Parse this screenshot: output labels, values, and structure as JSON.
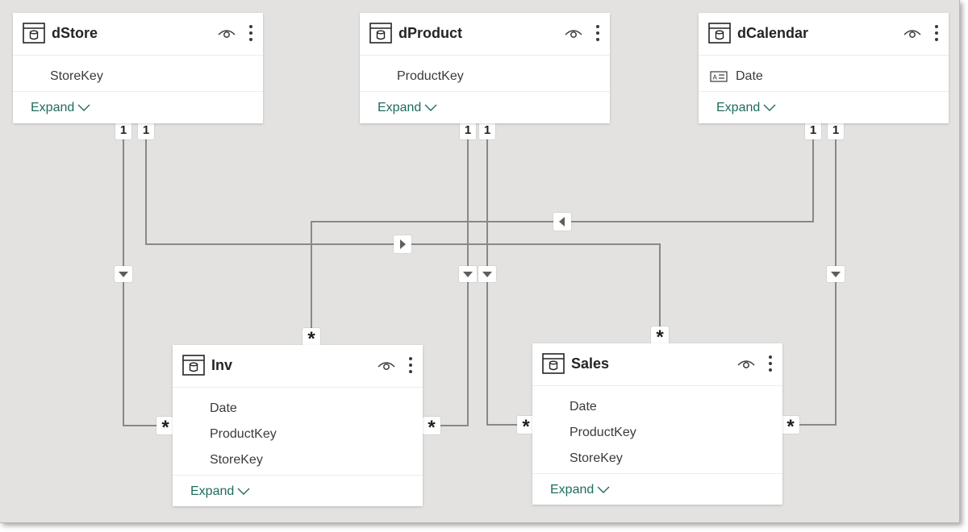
{
  "tables": {
    "dStore": {
      "title": "dStore",
      "fields": [
        "StoreKey"
      ],
      "expand_label": "Expand"
    },
    "dProduct": {
      "title": "dProduct",
      "fields": [
        "ProductKey"
      ],
      "expand_label": "Expand"
    },
    "dCalendar": {
      "title": "dCalendar",
      "fields": [
        "Date"
      ],
      "expand_label": "Expand"
    },
    "Inv": {
      "title": "Inv",
      "fields": [
        "Date",
        "ProductKey",
        "StoreKey"
      ],
      "expand_label": "Expand"
    },
    "Sales": {
      "title": "Sales",
      "fields": [
        "Date",
        "ProductKey",
        "StoreKey"
      ],
      "expand_label": "Expand"
    }
  },
  "cardinality": {
    "one": "1",
    "many": "*"
  },
  "relationships": [
    {
      "from": "dStore",
      "to": "Inv",
      "from_card": "1",
      "to_card": "*"
    },
    {
      "from": "dStore",
      "to": "Sales",
      "from_card": "1",
      "to_card": "*"
    },
    {
      "from": "dProduct",
      "to": "Inv",
      "from_card": "1",
      "to_card": "*"
    },
    {
      "from": "dProduct",
      "to": "Sales",
      "from_card": "1",
      "to_card": "*"
    },
    {
      "from": "dCalendar",
      "to": "Inv",
      "from_card": "1",
      "to_card": "*"
    },
    {
      "from": "dCalendar",
      "to": "Sales",
      "from_card": "1",
      "to_card": "*"
    }
  ],
  "icons": {
    "table": "table-icon",
    "visibility": "eye-icon",
    "more": "more-options-icon",
    "expand": "chevron-down-icon",
    "date_field": "date-field-icon",
    "filter_direction": "triangle-arrow-icon"
  },
  "colors": {
    "canvas": "#e3e2e0",
    "line": "#8a8886",
    "expand_link": "#1f6b5e",
    "title": "#252423"
  }
}
